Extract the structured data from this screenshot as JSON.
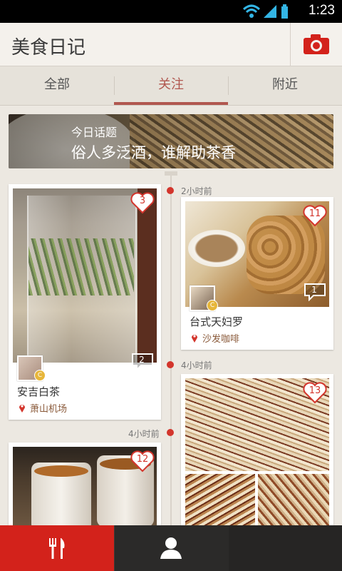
{
  "status_bar": {
    "time": "1:23"
  },
  "app_bar": {
    "title": "美食日记",
    "camera_icon": "camera-icon",
    "accent": "#d3221b"
  },
  "tabs": [
    {
      "label": "全部",
      "active": false
    },
    {
      "label": "关注",
      "active": true
    },
    {
      "label": "附近",
      "active": false
    }
  ],
  "banner": {
    "label": "今日话题",
    "headline": "俗人多泛酒，谁解助茶香"
  },
  "timeline": [
    "2小时前",
    "4小时前",
    "4小时前"
  ],
  "cards": [
    {
      "likes": "3",
      "comments": "2",
      "dish": "安吉白茶",
      "location": "萧山机场"
    },
    {
      "likes": "11",
      "comments": "1",
      "dish": "台式天妇罗",
      "location": "沙发咖啡"
    },
    {
      "likes": "13"
    },
    {
      "likes": "12"
    }
  ],
  "bottom_nav": [
    "food-icon",
    "profile-icon",
    "more-icon"
  ]
}
